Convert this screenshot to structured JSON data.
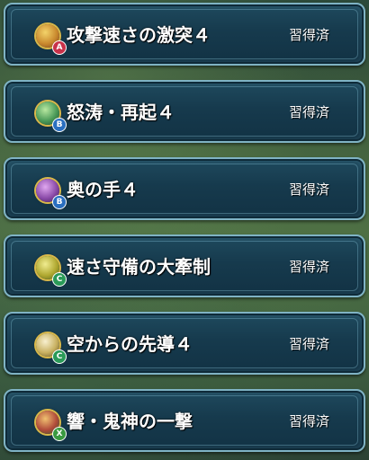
{
  "skills": [
    {
      "name": "攻撃速さの激突４",
      "status": "習得済",
      "slot": "A",
      "icon": "red-gold-skill-icon",
      "icon_color": "#c9892e",
      "slot_color": "#c8324a"
    },
    {
      "name": "怒涛・再起４",
      "status": "習得済",
      "slot": "B",
      "icon": "green-cross-skill-icon",
      "icon_color": "#4a9a58",
      "slot_color": "#2a6fc0"
    },
    {
      "name": "奥の手４",
      "status": "習得済",
      "slot": "B",
      "icon": "purple-skill-icon",
      "icon_color": "#8a4aa8",
      "slot_color": "#2a6fc0"
    },
    {
      "name": "速さ守備の大牽制",
      "status": "習得済",
      "slot": "C",
      "icon": "yellow-green-skill-icon",
      "icon_color": "#b0a830",
      "slot_color": "#2a9a58"
    },
    {
      "name": "空からの先導４",
      "status": "習得済",
      "slot": "C",
      "icon": "wing-skill-icon",
      "icon_color": "#c8b060",
      "slot_color": "#2a9a58"
    },
    {
      "name": "響・鬼神の一撃",
      "status": "習得済",
      "slot": "X",
      "icon": "red-green-skill-icon",
      "icon_color": "#b04a3a",
      "slot_color": "#3a9a40"
    }
  ]
}
